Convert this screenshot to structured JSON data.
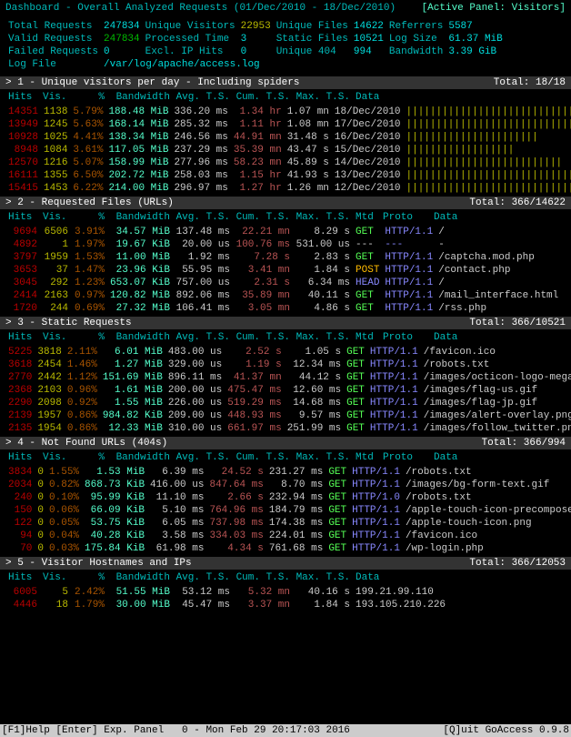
{
  "header": {
    "title": "Dashboard - Overall Analyzed Requests (01/Dec/2010 - 18/Dec/2010)",
    "active": "[Active Panel: Visitors]"
  },
  "summary": {
    "r1": {
      "total_req_l": "Total Requests",
      "total_req": "247834",
      "uniq_vis_l": "Unique Visitors",
      "uniq_vis": "22953",
      "uniq_files_l": "Unique Files",
      "uniq_files": "14622",
      "ref_l": "Referrers",
      "ref": "5587"
    },
    "r2": {
      "valid_req_l": "Valid Requests",
      "valid_req": "247834",
      "proc_time_l": "Processed Time",
      "proc_time": "3",
      "static_l": "Static Files",
      "static": "10521",
      "log_size_l": "Log Size",
      "log_size": "61.37 MiB"
    },
    "r3": {
      "failed_l": "Failed Requests",
      "failed": "0",
      "excl_l": "Excl. IP Hits",
      "excl": "0",
      "u404_l": "Unique 404",
      "u404": "994",
      "bw_l": "Bandwidth",
      "bw": "3.39 GiB"
    },
    "r4": {
      "log_l": "Log File",
      "log": "/var/log/apache/access.log"
    }
  },
  "cols_basic": {
    "hits": "Hits",
    "vis": "Vis.",
    "pct": "%",
    "bw": "Bandwidth",
    "avg": "Avg. T.S.",
    "cum": "Cum. T.S.",
    "max": "Max. T.S.",
    "data": "Data"
  },
  "cols_ext": {
    "hits": "Hits",
    "vis": "Vis.",
    "pct": "%",
    "bw": "Bandwidth",
    "avg": "Avg. T.S.",
    "cum": "Cum. T.S.",
    "max": "Max. T.S.",
    "mtd": "Mtd",
    "proto": "Proto",
    "data": "Data"
  },
  "panels": [
    {
      "id": "1",
      "title": "1 - Unique visitors per day - Including spiders",
      "total": "Total: 18/18",
      "cols": "basic",
      "rows": [
        {
          "hits": "14351",
          "vis": "1138",
          "pct": "5.79%",
          "bw": "188.48 MiB",
          "avg": "336.20 ms",
          "cum": "  1.34 hr",
          "max": " 1.07 mn",
          "data": "18/Dec/2010",
          "bar": "||||||||||||||||||||||||||||||"
        },
        {
          "hits": "13949",
          "vis": "1245",
          "pct": "5.63%",
          "bw": "168.14 MiB",
          "avg": "285.32 ms",
          "cum": "  1.11 hr",
          "max": " 1.08 mn",
          "data": "17/Dec/2010",
          "bar": "|||||||||||||||||||||||||||||"
        },
        {
          "hits": "10928",
          "vis": "1025",
          "pct": "4.41%",
          "bw": "138.34 MiB",
          "avg": "246.56 ms",
          "cum": " 44.91 mn",
          "max": "31.48  s",
          "data": "16/Dec/2010",
          "bar": "||||||||||||||||||||||"
        },
        {
          "hits": " 8948",
          "vis": "1084",
          "pct": "3.61%",
          "bw": "117.05 MiB",
          "avg": "237.29 ms",
          "cum": " 35.39 mn",
          "max": "43.47  s",
          "data": "15/Dec/2010",
          "bar": "||||||||||||||||||"
        },
        {
          "hits": "12570",
          "vis": "1216",
          "pct": "5.07%",
          "bw": "158.99 MiB",
          "avg": "277.96 ms",
          "cum": " 58.23 mn",
          "max": "45.89  s",
          "data": "14/Dec/2010",
          "bar": "||||||||||||||||||||||||||"
        },
        {
          "hits": "16111",
          "vis": "1355",
          "pct": "6.50%",
          "bw": "202.72 MiB",
          "avg": "258.03 ms",
          "cum": "  1.15 hr",
          "max": "41.93  s",
          "data": "13/Dec/2010",
          "bar": "||||||||||||||||||||||||||||||||||"
        },
        {
          "hits": "15415",
          "vis": "1453",
          "pct": "6.22%",
          "bw": "214.00 MiB",
          "avg": "296.97 ms",
          "cum": "  1.27 hr",
          "max": " 1.26 mn",
          "data": "12/Dec/2010",
          "bar": "||||||||||||||||||||||||||||||||"
        }
      ]
    },
    {
      "id": "2",
      "title": "2 - Requested Files (URLs)",
      "total": "Total: 366/14622",
      "cols": "ext",
      "rows": [
        {
          "hits": "9694",
          "vis": "6506",
          "pct": "3.91%",
          "bw": " 34.57 MiB",
          "avg": "137.48 ms",
          "cum": " 22.21 mn",
          "max": "  8.29  s",
          "mtd": "GET",
          "proto": "HTTP/1.1",
          "data": "/"
        },
        {
          "hits": "4892",
          "vis": "   1",
          "pct": "1.97%",
          "bw": " 19.67 KiB",
          "avg": " 20.00 us",
          "cum": "100.76 ms",
          "max": "531.00 us",
          "mtd": "---",
          "proto": "---",
          "data": "-"
        },
        {
          "hits": "3797",
          "vis": "1959",
          "pct": "1.53%",
          "bw": " 11.00 MiB",
          "avg": "  1.92 ms",
          "cum": "  7.28  s",
          "max": "  2.83  s",
          "mtd": "GET",
          "proto": "HTTP/1.1",
          "data": "/captcha.mod.php"
        },
        {
          "hits": "3653",
          "vis": "  37",
          "pct": "1.47%",
          "bw": " 23.96 KiB",
          "avg": " 55.95 ms",
          "cum": "  3.41 mn",
          "max": "  1.84  s",
          "mtd": "POST",
          "proto": "HTTP/1.1",
          "data": "/contact.php"
        },
        {
          "hits": "3045",
          "vis": " 292",
          "pct": "1.23%",
          "bw": "653.07 KiB",
          "avg": "757.00 us",
          "cum": "  2.31  s",
          "max": "  6.34 ms",
          "mtd": "HEAD",
          "proto": "HTTP/1.1",
          "data": "/"
        },
        {
          "hits": "2414",
          "vis": "2163",
          "pct": "0.97%",
          "bw": "120.82 MiB",
          "avg": "892.06 ms",
          "cum": " 35.89 mn",
          "max": " 40.11  s",
          "mtd": "GET",
          "proto": "HTTP/1.1",
          "data": "/mail_interface.html"
        },
        {
          "hits": "1720",
          "vis": " 244",
          "pct": "0.69%",
          "bw": " 27.32 MiB",
          "avg": "106.41 ms",
          "cum": "  3.05 mn",
          "max": "  4.86  s",
          "mtd": "GET",
          "proto": "HTTP/1.1",
          "data": "/rss.php"
        }
      ]
    },
    {
      "id": "3",
      "title": "3 - Static Requests",
      "total": "Total: 366/10521",
      "cols": "ext",
      "rows": [
        {
          "hits": "5225",
          "vis": "3818",
          "pct": "2.11%",
          "bw": "  6.01 MiB",
          "avg": "483.00 us",
          "cum": "  2.52  s",
          "max": "  1.05  s",
          "mtd": "GET",
          "proto": "HTTP/1.1",
          "data": "/favicon.ico"
        },
        {
          "hits": "3618",
          "vis": "2454",
          "pct": "1.46%",
          "bw": "  1.27 MiB",
          "avg": "329.00 us",
          "cum": "  1.19  s",
          "max": " 12.34 ms",
          "mtd": "GET",
          "proto": "HTTP/1.1",
          "data": "/robots.txt"
        },
        {
          "hits": "2770",
          "vis": "2442",
          "pct": "1.12%",
          "bw": "151.69 MiB",
          "avg": "896.11 ms",
          "cum": " 41.37 mn",
          "max": " 44.12  s",
          "mtd": "GET",
          "proto": "HTTP/1.1",
          "data": "/images/octicon-logo-mega.png"
        },
        {
          "hits": "2368",
          "vis": "2103",
          "pct": "0.96%",
          "bw": "  1.61 MiB",
          "avg": "200.00 us",
          "cum": "475.47 ms",
          "max": " 12.60 ms",
          "mtd": "GET",
          "proto": "HTTP/1.1",
          "data": "/images/flag-us.gif"
        },
        {
          "hits": "2290",
          "vis": "2098",
          "pct": "0.92%",
          "bw": "  1.55 MiB",
          "avg": "226.00 us",
          "cum": "519.29 ms",
          "max": " 14.68 ms",
          "mtd": "GET",
          "proto": "HTTP/1.1",
          "data": "/images/flag-jp.gif"
        },
        {
          "hits": "2139",
          "vis": "1957",
          "pct": "0.86%",
          "bw": "984.82 KiB",
          "avg": "209.00 us",
          "cum": "448.93 ms",
          "max": "  9.57 ms",
          "mtd": "GET",
          "proto": "HTTP/1.1",
          "data": "/images/alert-overlay.png"
        },
        {
          "hits": "2135",
          "vis": "1954",
          "pct": "0.86%",
          "bw": " 12.33 MiB",
          "avg": "310.00 us",
          "cum": "661.97 ms",
          "max": "251.99 ms",
          "mtd": "GET",
          "proto": "HTTP/1.1",
          "data": "/images/follow_twitter.png"
        }
      ]
    },
    {
      "id": "4",
      "title": "4 - Not Found URLs (404s)",
      "total": "Total: 366/994",
      "cols": "ext",
      "rows": [
        {
          "hits": "3834",
          "vis": "   0",
          "pct": "1.55%",
          "bw": "  1.53 MiB",
          "avg": "  6.39 ms",
          "cum": " 24.52  s",
          "max": "231.27 ms",
          "mtd": "GET",
          "proto": "HTTP/1.1",
          "data": "/robots.txt"
        },
        {
          "hits": "2034",
          "vis": "   0",
          "pct": "0.82%",
          "bw": "868.73 KiB",
          "avg": "416.00 us",
          "cum": "847.64 ms",
          "max": "  8.70 ms",
          "mtd": "GET",
          "proto": "HTTP/1.1",
          "data": "/images/bg-form-text.gif"
        },
        {
          "hits": " 240",
          "vis": "   0",
          "pct": "0.10%",
          "bw": " 95.99 KiB",
          "avg": " 11.10 ms",
          "cum": "  2.66  s",
          "max": "232.94 ms",
          "mtd": "GET",
          "proto": "HTTP/1.0",
          "data": "/robots.txt"
        },
        {
          "hits": " 150",
          "vis": "   0",
          "pct": "0.06%",
          "bw": " 66.09 KiB",
          "avg": "  5.10 ms",
          "cum": "764.96 ms",
          "max": "184.79 ms",
          "mtd": "GET",
          "proto": "HTTP/1.1",
          "data": "/apple-touch-icon-precomposed.pn"
        },
        {
          "hits": " 122",
          "vis": "   0",
          "pct": "0.05%",
          "bw": " 53.75 KiB",
          "avg": "  6.05 ms",
          "cum": "737.98 ms",
          "max": "174.38 ms",
          "mtd": "GET",
          "proto": "HTTP/1.1",
          "data": "/apple-touch-icon.png"
        },
        {
          "hits": "  94",
          "vis": "   0",
          "pct": "0.04%",
          "bw": " 40.28 KiB",
          "avg": "  3.58 ms",
          "cum": "334.03 ms",
          "max": "224.01 ms",
          "mtd": "GET",
          "proto": "HTTP/1.1",
          "data": "/favicon.ico"
        },
        {
          "hits": "  70",
          "vis": "   0",
          "pct": "0.03%",
          "bw": "175.84 KiB",
          "avg": " 61.98 ms",
          "cum": "  4.34  s",
          "max": "761.68 ms",
          "mtd": "GET",
          "proto": "HTTP/1.1",
          "data": "/wp-login.php"
        }
      ]
    },
    {
      "id": "5",
      "title": "5 - Visitor Hostnames and IPs",
      "total": "Total: 366/12053",
      "cols": "basic",
      "rows": [
        {
          "hits": "6005",
          "vis": "   5",
          "pct": "2.42%",
          "bw": " 51.55 MiB",
          "avg": " 53.12 ms",
          "cum": "  5.32 mn",
          "max": " 40.16  s",
          "data": "199.21.99.110"
        },
        {
          "hits": "4446",
          "vis": "  18",
          "pct": "1.79%",
          "bw": " 30.00 MiB",
          "avg": " 45.47 ms",
          "cum": "  3.37 mn",
          "max": "  1.84  s",
          "data": "193.105.210.226"
        }
      ]
    }
  ],
  "footer": {
    "help": "[F1]Help [Enter] Exp. Panel",
    "status": "0 - Mon Feb 29 20:17:03 2016",
    "quit": "[Q]uit GoAccess 0.9.8"
  }
}
